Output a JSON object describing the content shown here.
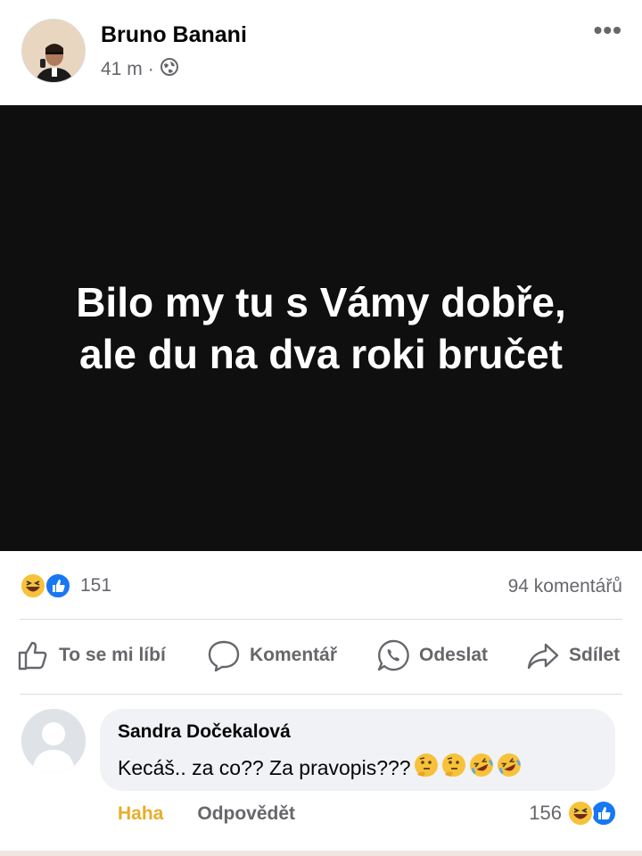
{
  "post": {
    "author": "Bruno Banani",
    "time": "41 m",
    "separator": "·",
    "text_line1": "Bilo my tu s Vámy dobře,",
    "text_line2": "ale du na dva roki bručet",
    "reaction_count": "151",
    "comments_count": "94 komentářů",
    "reaction_icons": [
      "haha-icon",
      "like-icon"
    ],
    "privacy_icon": "globe-icon"
  },
  "actions": {
    "like": "To se mi líbí",
    "comment": "Komentář",
    "send": "Odeslat",
    "share": "Sdílet"
  },
  "comment": {
    "author": "Sandra Dočekalová",
    "text": "Kecáš.. za co?? Za pravopis???",
    "emojis": [
      "thinking-face",
      "thinking-face",
      "rolling-laughing-face",
      "rolling-laughing-face"
    ],
    "haha_label": "Haha",
    "reply_label": "Odpovědět",
    "reaction_count": "156"
  },
  "colors": {
    "image_bg": "#0f0f0f",
    "haha_yellow": "#e9ad29",
    "like_blue": "#1877f2",
    "muted_text": "#65676b"
  }
}
